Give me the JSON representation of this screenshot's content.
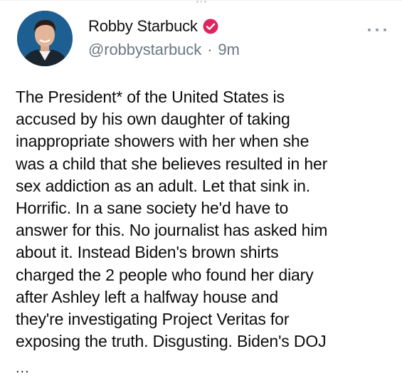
{
  "tweet": {
    "author": {
      "display_name": "Robby Starbuck",
      "handle": "@robbystarbuck",
      "verified_icon": "verified-badge-icon",
      "avatar_icon": "avatar"
    },
    "separator": "·",
    "time": "9m",
    "more_icon": "more-options-icon",
    "text": "The President* of the United States is\naccused by his own daughter of taking\ninappropriate showers with her when she\nwas a child that she believes resulted in her\nsex addiction as an adult. Let that sink in.\nHorrific. In a sane society he'd have to\nanswer for this. No journalist has asked him\nabout it. Instead Biden's brown shirts\ncharged the 2 people who found her diary\nafter Ashley left a halfway house and\nthey're investigating Project Veritas for\nexposing the truth. Disgusting. Biden's DOJ",
    "truncation": "..."
  },
  "colors": {
    "verified_badge": "#e0245e",
    "secondary_text": "#6c7883",
    "primary_text": "#0c0c0c",
    "avatar_bg": "#1d5f91"
  }
}
